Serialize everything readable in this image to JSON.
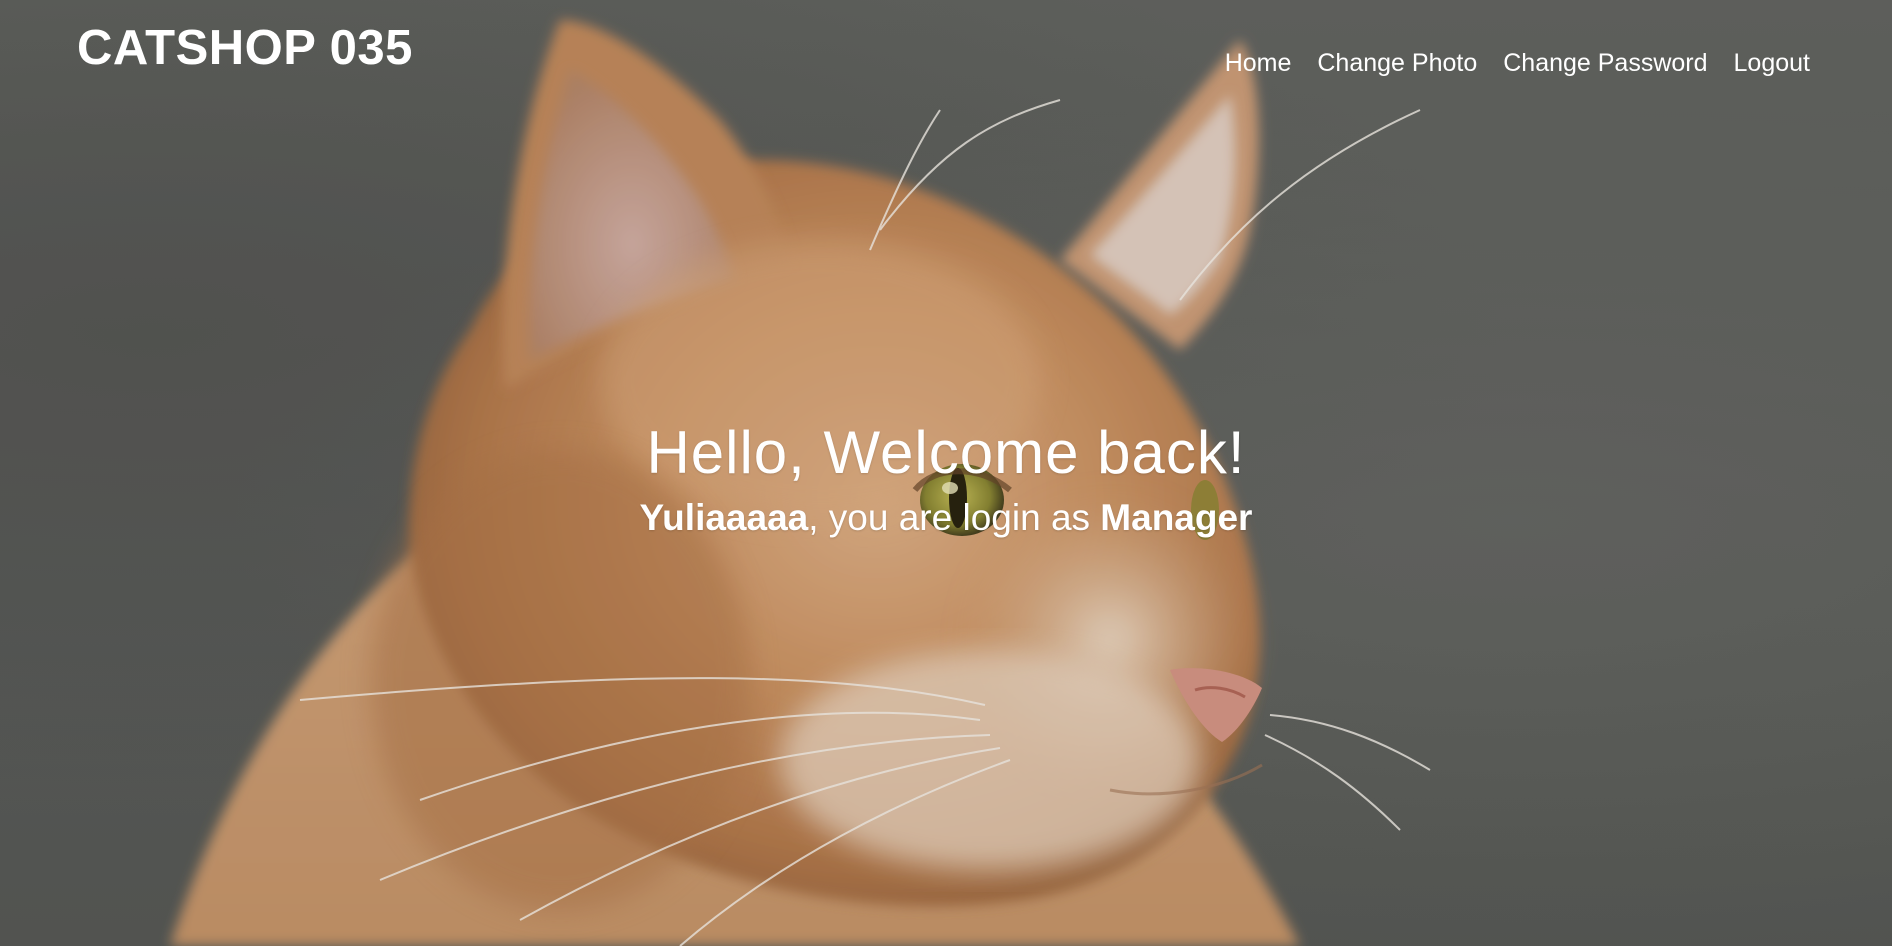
{
  "navbar": {
    "brand": "CATSHOP 035",
    "links": [
      {
        "label": "Home"
      },
      {
        "label": "Change Photo"
      },
      {
        "label": "Change Password"
      },
      {
        "label": "Logout"
      }
    ]
  },
  "hero": {
    "title": "Hello, Welcome back!",
    "username": "Yuliaaaaa",
    "middle_text": ", you are login as ",
    "role": "Manager"
  },
  "colors": {
    "text": "#ffffff",
    "background": "#5f605d",
    "cat_fur": "#c98e5f"
  }
}
